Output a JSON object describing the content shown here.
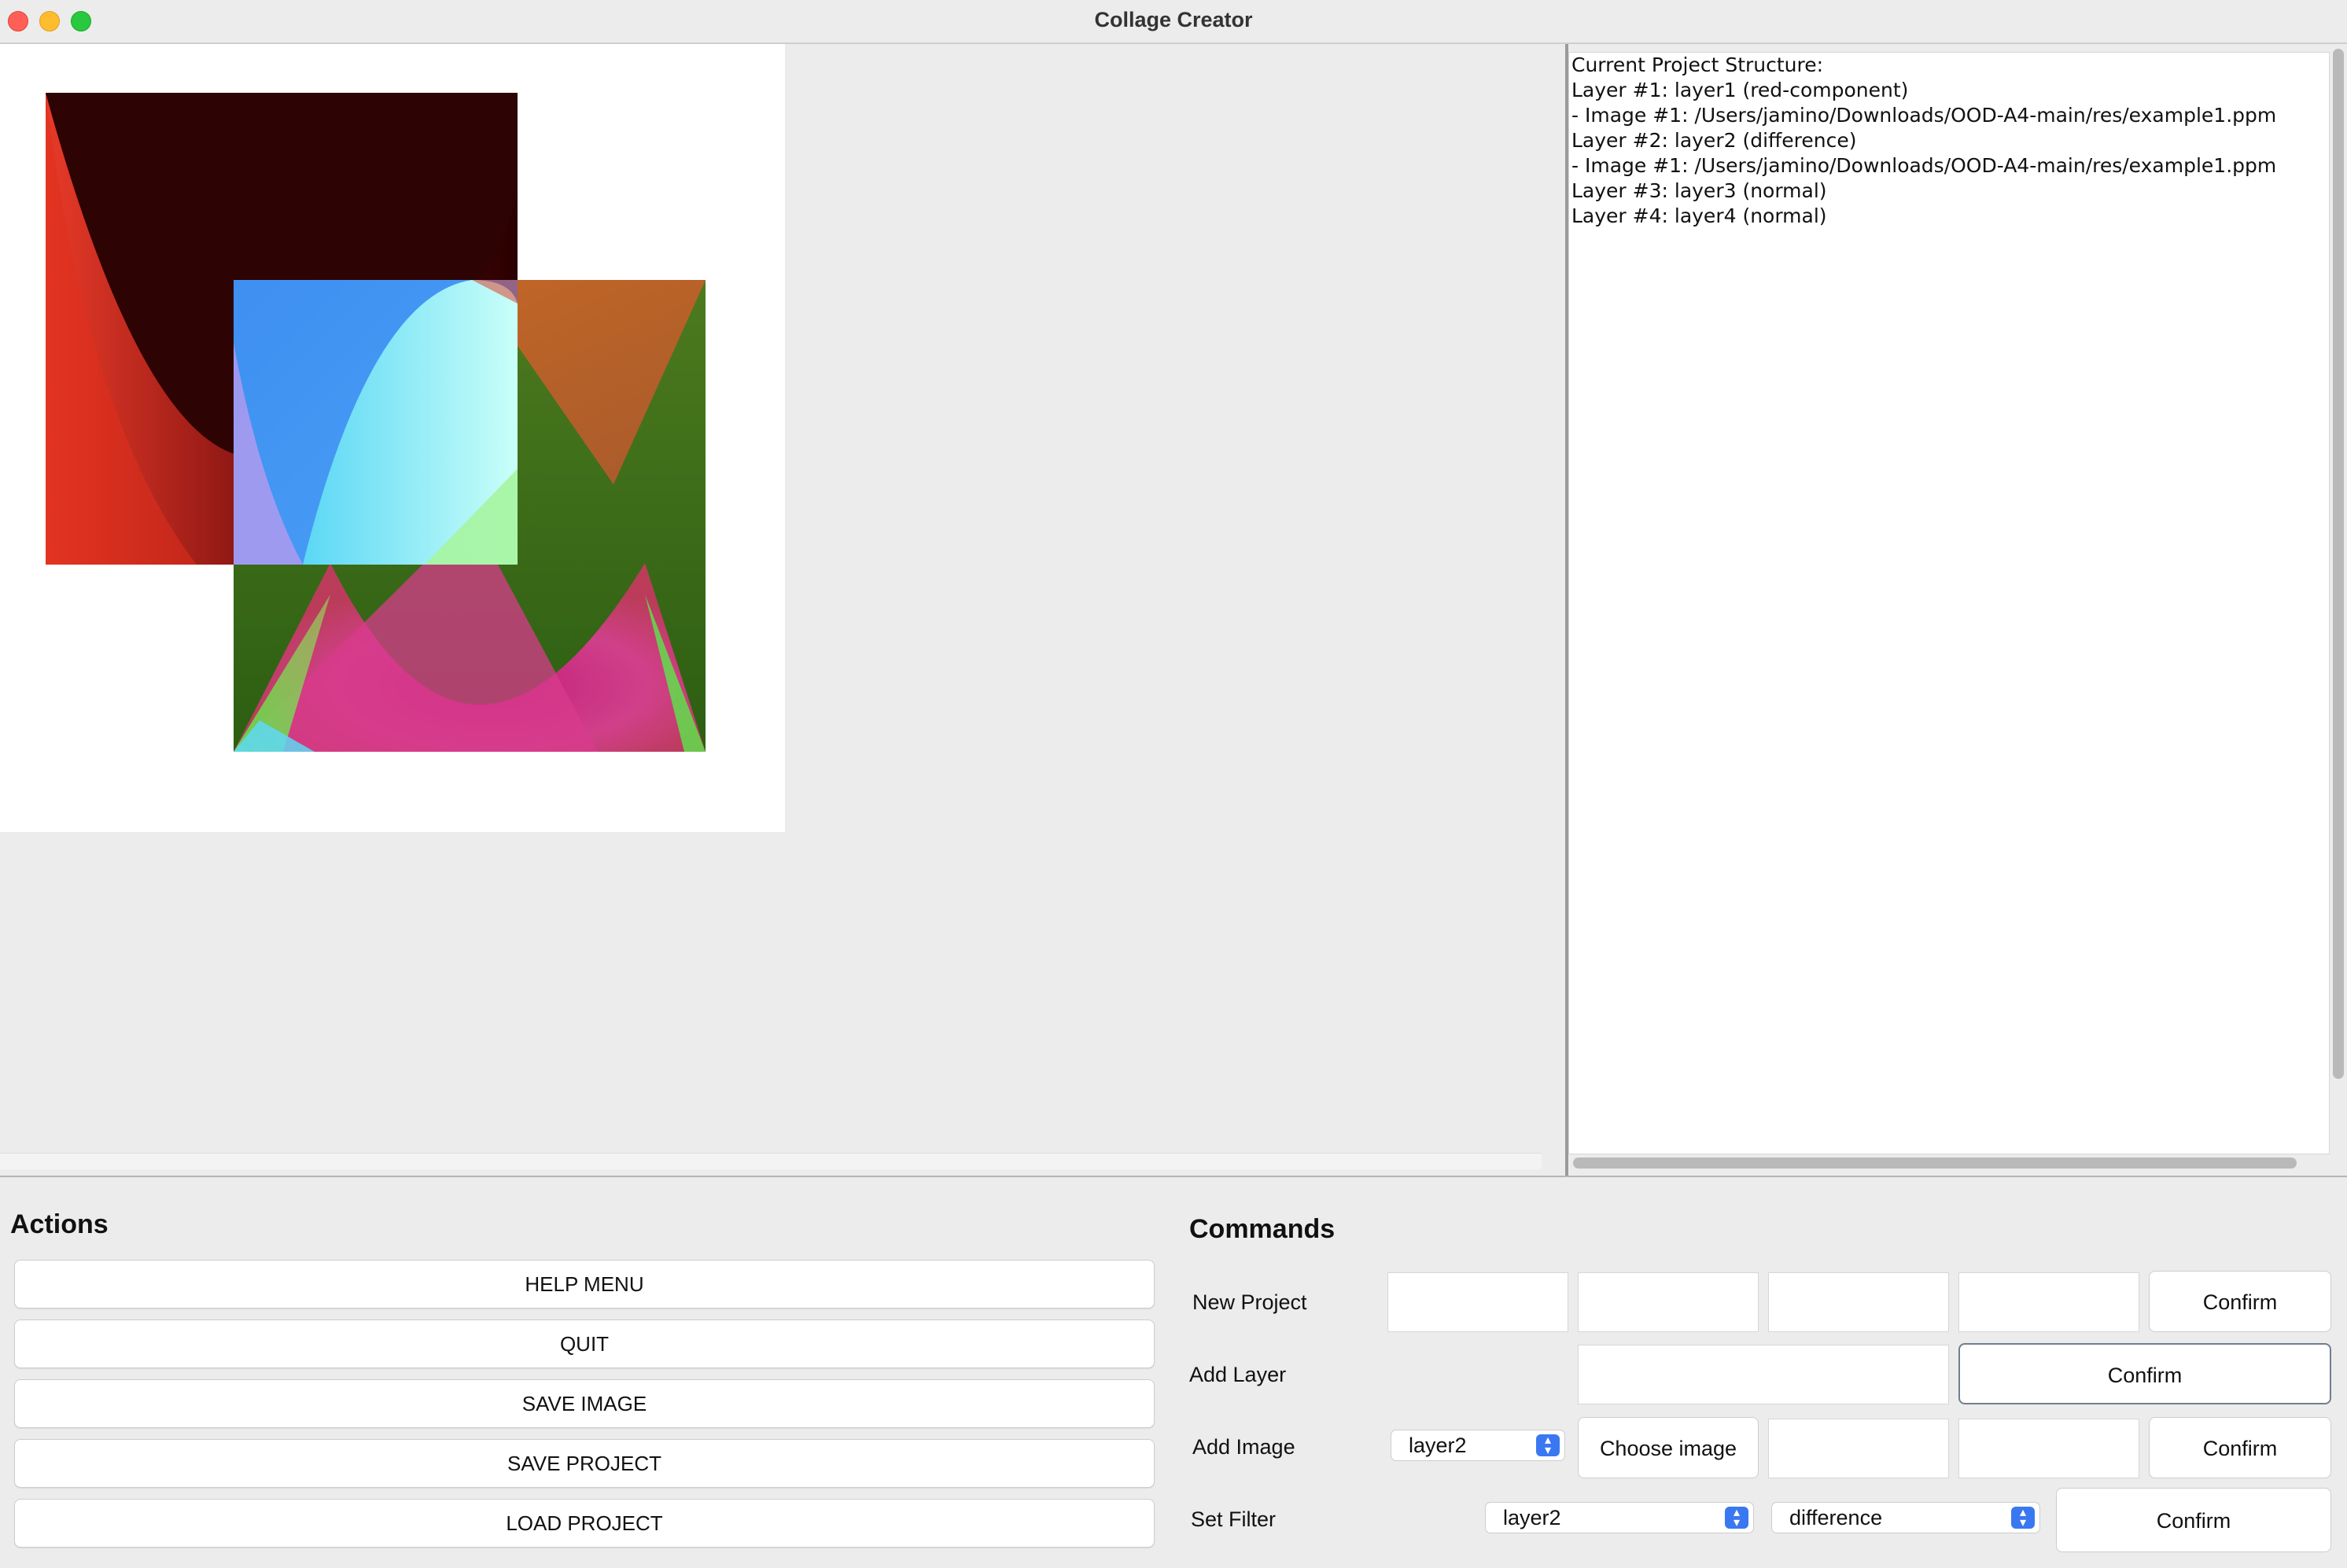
{
  "window": {
    "title": "Collage Creator"
  },
  "structure": {
    "lines": [
      "Current Project Structure:",
      "Layer #1: layer1 (red-component)",
      " - Image #1: /Users/jamino/Downloads/OOD-A4-main/res/example1.ppm",
      "Layer #2: layer2 (difference)",
      " - Image #1: /Users/jamino/Downloads/OOD-A4-main/res/example1.ppm",
      "Layer #3: layer3 (normal)",
      "Layer #4: layer4 (normal)"
    ]
  },
  "actions": {
    "title": "Actions",
    "buttons": [
      "HELP MENU",
      "QUIT",
      "SAVE IMAGE",
      "SAVE PROJECT",
      "LOAD PROJECT"
    ]
  },
  "commands": {
    "title": "Commands",
    "new_project": {
      "label": "New Project",
      "confirm": "Confirm"
    },
    "add_layer": {
      "label": "Add Layer",
      "confirm": "Confirm"
    },
    "add_image": {
      "label": "Add Image",
      "layer_selected": "layer2",
      "choose": "Choose image",
      "confirm": "Confirm"
    },
    "set_filter": {
      "label": "Set Filter",
      "layer_selected": "layer2",
      "filter_selected": "difference",
      "confirm": "Confirm"
    }
  },
  "colors": {
    "accent": "#3a78f2",
    "window_bg": "#ececec",
    "panel_bg": "#ffffff"
  }
}
